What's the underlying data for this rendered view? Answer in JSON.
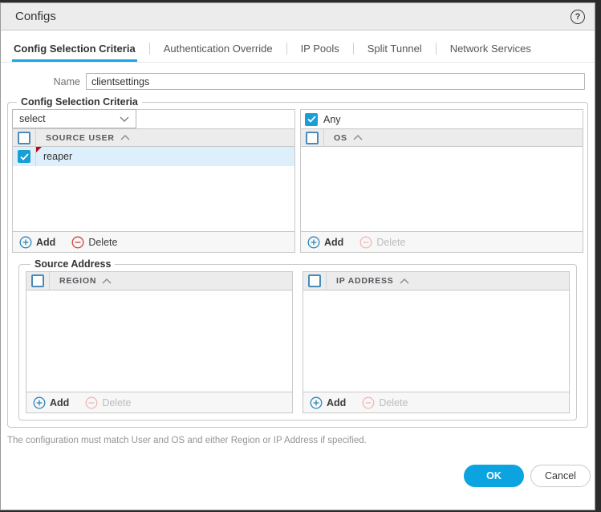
{
  "colors": {
    "accent_blue": "#0ba4e0",
    "checkbox_blue": "#189fd6",
    "tab_underline": "#1ba8e2",
    "selected_row": "#ddeffa",
    "modified_flag_red": "#c00707",
    "delete_red": "#d0433c",
    "titlebar_gray": "#ececec"
  },
  "titlebar": {
    "title": "Configs",
    "help_glyph": "?"
  },
  "tabs": [
    {
      "label": "Config Selection Criteria",
      "active": true
    },
    {
      "label": "Authentication Override",
      "active": false
    },
    {
      "label": "IP Pools",
      "active": false
    },
    {
      "label": "Split Tunnel",
      "active": false
    },
    {
      "label": "Network Services",
      "active": false
    }
  ],
  "name_field": {
    "label": "Name",
    "value": "clientsettings"
  },
  "criteria_group": {
    "legend": "Config Selection Criteria",
    "user_panel": {
      "filter_dropdown": {
        "value": "select"
      },
      "column": "SOURCE USER",
      "rows": [
        {
          "value": "reaper",
          "checked": true,
          "selected": true,
          "modified": true
        }
      ],
      "add_label": "Add",
      "delete_label": "Delete",
      "delete_enabled": true
    },
    "os_panel": {
      "any_label": "Any",
      "any_checked": true,
      "column": "OS",
      "rows": [],
      "add_label": "Add",
      "delete_label": "Delete",
      "delete_enabled": false
    },
    "source_address_group": {
      "legend": "Source Address",
      "region_panel": {
        "column": "REGION",
        "rows": [],
        "add_label": "Add",
        "delete_label": "Delete",
        "delete_enabled": false
      },
      "ip_panel": {
        "column": "IP ADDRESS",
        "rows": [],
        "add_label": "Add",
        "delete_label": "Delete",
        "delete_enabled": false
      }
    }
  },
  "note": "The configuration must match User and OS and either Region or IP Address if specified.",
  "footer": {
    "ok_label": "OK",
    "cancel_label": "Cancel"
  }
}
